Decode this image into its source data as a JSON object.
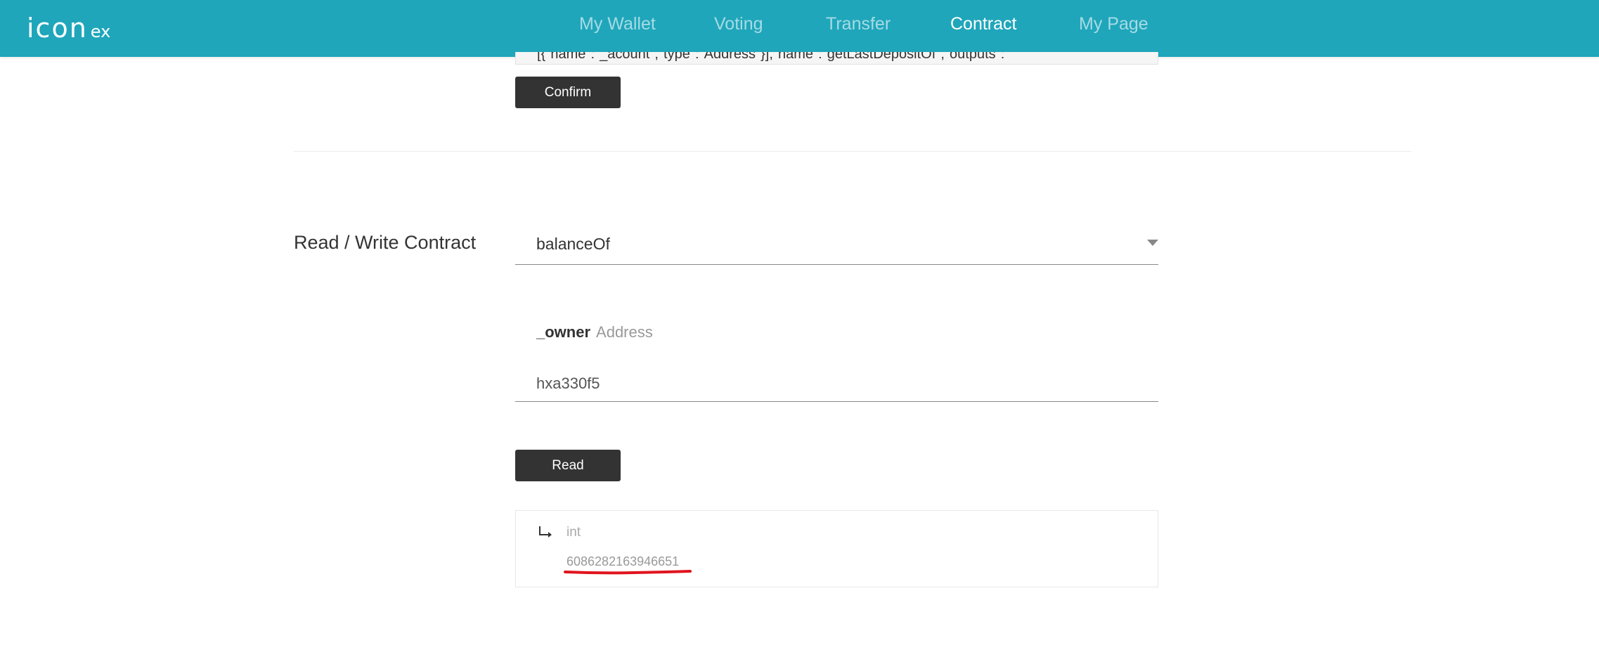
{
  "app": {
    "logo_main": "icon",
    "logo_ex": "ex"
  },
  "nav": {
    "items": [
      {
        "label": "My Wallet",
        "active": false
      },
      {
        "label": "Voting",
        "active": false
      },
      {
        "label": "Transfer",
        "active": false
      },
      {
        "label": "Contract",
        "active": true
      },
      {
        "label": "My Page",
        "active": false
      }
    ]
  },
  "abi": {
    "visible_text": "[{\"name\":\"_acount\",\"type\":\"Address\"}],\"name\":\"getLastDepositOf\",\"outputs\":"
  },
  "buttons": {
    "confirm_label": "Confirm",
    "read_label": "Read"
  },
  "contract": {
    "section_label": "Read / Write Contract",
    "selected_method": "balanceOf",
    "param_name": "_owner",
    "param_type": "Address",
    "param_value": "hxa330f5"
  },
  "result": {
    "type": "int",
    "value": "6086282163946651"
  },
  "colors": {
    "header_bg": "#1fa6bb",
    "button_bg": "#333333",
    "highlight_red": "#e0141e"
  }
}
